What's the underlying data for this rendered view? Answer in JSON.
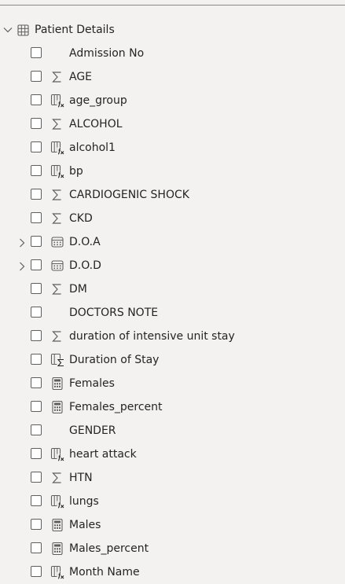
{
  "table": {
    "name": "Patient Details",
    "icon": "table-icon",
    "expanded": true
  },
  "fields": [
    {
      "label": "Admission No",
      "icon": "none",
      "expandable": false,
      "checked": false
    },
    {
      "label": "AGE",
      "icon": "sigma-icon",
      "expandable": false,
      "checked": false
    },
    {
      "label": "age_group",
      "icon": "calculated-column-icon",
      "expandable": false,
      "checked": false
    },
    {
      "label": "ALCOHOL",
      "icon": "sigma-icon",
      "expandable": false,
      "checked": false
    },
    {
      "label": "alcohol1",
      "icon": "calculated-column-icon",
      "expandable": false,
      "checked": false
    },
    {
      "label": "bp",
      "icon": "calculated-column-icon",
      "expandable": false,
      "checked": false
    },
    {
      "label": "CARDIOGENIC SHOCK",
      "icon": "sigma-icon",
      "expandable": false,
      "checked": false
    },
    {
      "label": "CKD",
      "icon": "sigma-icon",
      "expandable": false,
      "checked": false
    },
    {
      "label": "D.O.A",
      "icon": "calendar-icon",
      "expandable": true,
      "checked": false
    },
    {
      "label": "D.O.D",
      "icon": "calendar-icon",
      "expandable": true,
      "checked": false
    },
    {
      "label": "DM",
      "icon": "sigma-icon",
      "expandable": false,
      "checked": false
    },
    {
      "label": "DOCTORS NOTE",
      "icon": "none",
      "expandable": false,
      "checked": false
    },
    {
      "label": "duration of intensive unit stay",
      "icon": "sigma-icon",
      "expandable": false,
      "checked": false
    },
    {
      "label": "Duration of Stay",
      "icon": "calculated-sigma-icon",
      "expandable": false,
      "checked": false
    },
    {
      "label": "Females",
      "icon": "calculator-icon",
      "expandable": false,
      "checked": false
    },
    {
      "label": "Females_percent",
      "icon": "calculator-icon",
      "expandable": false,
      "checked": false
    },
    {
      "label": "GENDER",
      "icon": "none",
      "expandable": false,
      "checked": false
    },
    {
      "label": "heart attack",
      "icon": "calculated-column-icon",
      "expandable": false,
      "checked": false
    },
    {
      "label": "HTN",
      "icon": "sigma-icon",
      "expandable": false,
      "checked": false
    },
    {
      "label": "lungs",
      "icon": "calculated-column-icon",
      "expandable": false,
      "checked": false
    },
    {
      "label": "Males",
      "icon": "calculator-icon",
      "expandable": false,
      "checked": false
    },
    {
      "label": "Males_percent",
      "icon": "calculator-icon",
      "expandable": false,
      "checked": false
    },
    {
      "label": "Month Name",
      "icon": "calculated-column-icon",
      "expandable": false,
      "checked": false
    }
  ],
  "colors": {
    "background": "#f3f2f1",
    "text": "#252423",
    "icon": "#605e5c",
    "divider": "#8a8886"
  }
}
